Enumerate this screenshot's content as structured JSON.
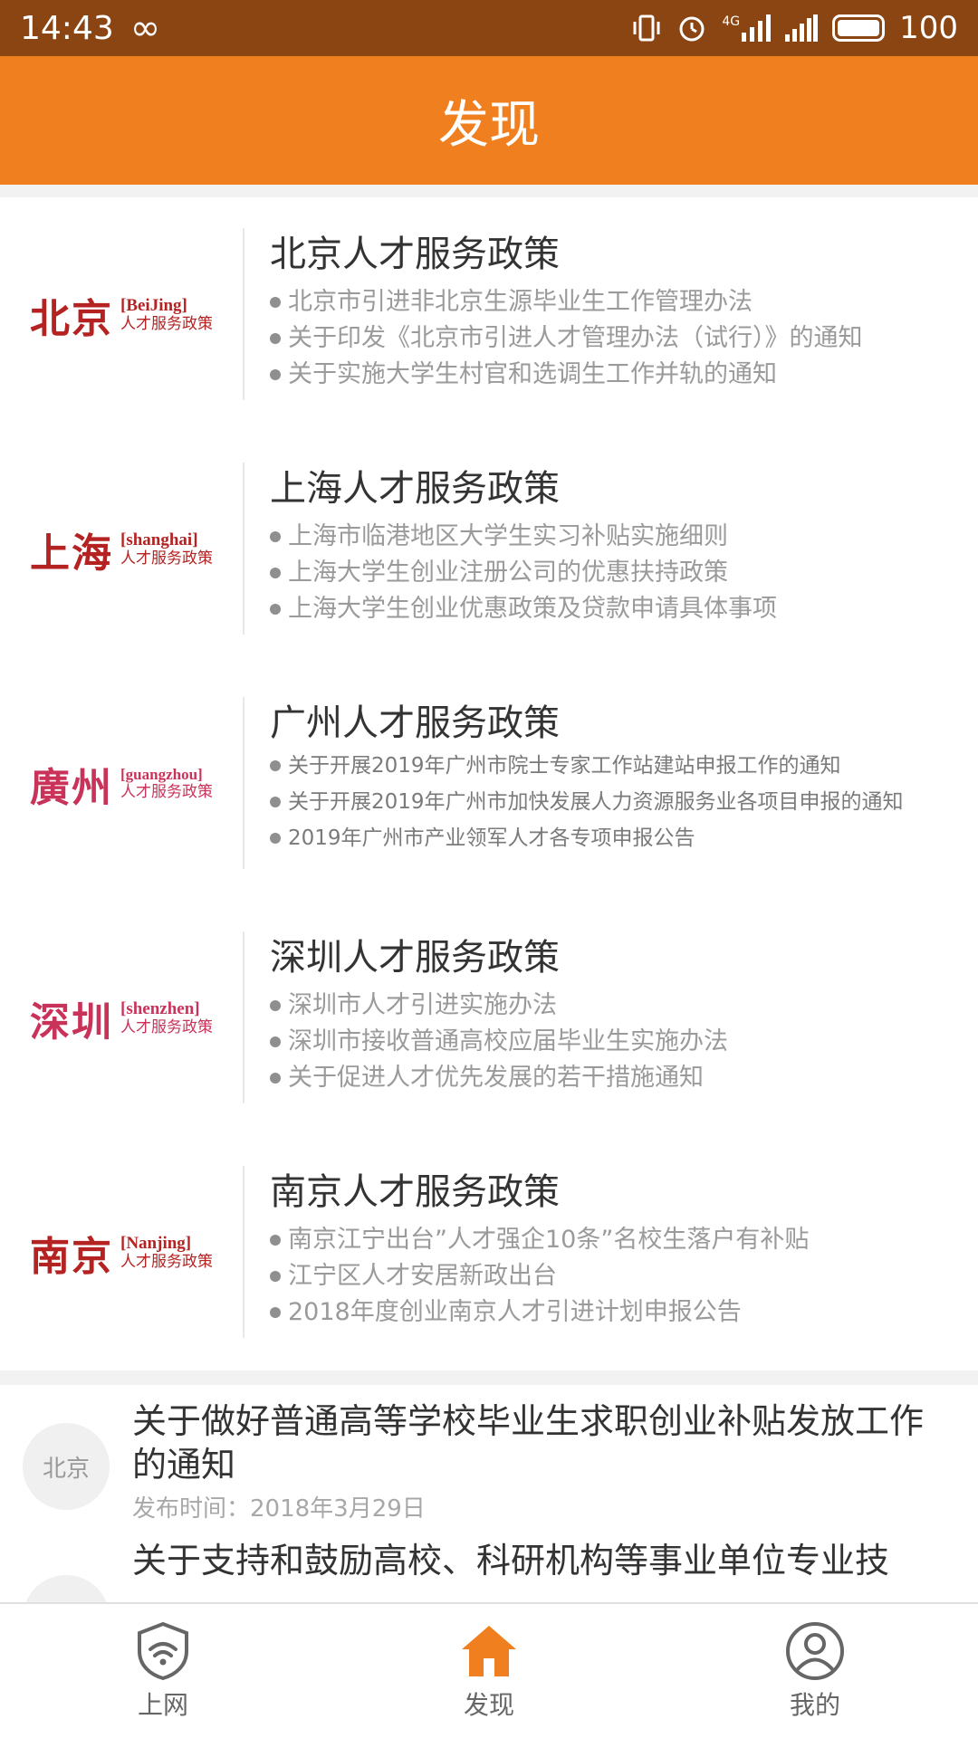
{
  "status_bar": {
    "time": "14:43",
    "network": "4G",
    "battery": "100"
  },
  "header": {
    "title": "发现"
  },
  "policies": [
    {
      "logo_cn": "北京",
      "logo_en": "[BeiJing]",
      "logo_sub": "人才服务政策",
      "logo_color": "#b52222",
      "title": "北京人才服务政策",
      "items": [
        "北京市引进非北京生源毕业生工作管理办法",
        "关于印发《北京市引进人才管理办法（试行）》的通知",
        "关于实施大学生村官和选调生工作并轨的通知"
      ]
    },
    {
      "logo_cn": "上海",
      "logo_en": "[shanghai]",
      "logo_sub": "人才服务政策",
      "logo_color": "#b52222",
      "title": "上海人才服务政策",
      "items": [
        "上海市临港地区大学生实习补贴实施细则",
        "上海大学生创业注册公司的优惠扶持政策",
        "上海大学生创业优惠政策及贷款申请具体事项"
      ]
    },
    {
      "logo_cn": "廣州",
      "logo_en": "[guangzhou]",
      "logo_sub": "人才服务政策",
      "logo_color": "#c9335a",
      "title": "广州人才服务政策",
      "items": [
        "关于开展2019年广州市院士专家工作站建站申报工作的通知",
        "关于开展2019年广州市加快发展人力资源服务业各项目申报的通知",
        "2019年广州市产业领军人才各专项申报公告"
      ]
    },
    {
      "logo_cn": "深圳",
      "logo_en": "[shenzhen]",
      "logo_sub": "人才服务政策",
      "logo_color": "#c9335a",
      "title": "深圳人才服务政策",
      "items": [
        "深圳市人才引进实施办法",
        "深圳市接收普通高校应届毕业生实施办法",
        "关于促进人才优先发展的若干措施通知"
      ]
    },
    {
      "logo_cn": "南京",
      "logo_en": "[Nanjing]",
      "logo_sub": "人才服务政策",
      "logo_color": "#b52222",
      "title": "南京人才服务政策",
      "items": [
        "南京江宁出台”人才强企10条”名校生落户有补贴",
        "江宁区人才安居新政出台",
        "2018年度创业南京人才引进计划申报公告"
      ]
    }
  ],
  "news": [
    {
      "tag": "北京",
      "title": "关于做好普通高等学校毕业生求职创业补贴发放工作的通知",
      "date": "发布时间：2018年3月29日"
    },
    {
      "tag": "",
      "title": "关于支持和鼓励高校、科研机构等事业单位专业技",
      "date": ""
    }
  ],
  "nav": [
    {
      "label": "上网",
      "icon": "wifi-shield-icon"
    },
    {
      "label": "发现",
      "icon": "home-icon"
    },
    {
      "label": "我的",
      "icon": "user-icon"
    }
  ],
  "colors": {
    "status_bar": "#8a4513",
    "header": "#f07f1f",
    "accent": "#f07f1f"
  }
}
